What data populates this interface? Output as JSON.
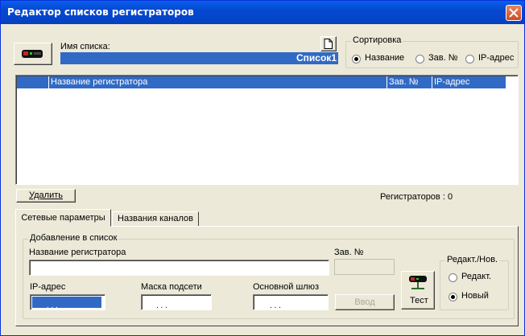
{
  "window": {
    "title": "Редактор списков регистраторов"
  },
  "list_name": {
    "label": "Имя списка:",
    "value": "Список1"
  },
  "sort": {
    "legend": "Сортировка",
    "options": [
      "Название",
      "Зав. №",
      "IP-адрес"
    ],
    "selected": "Название"
  },
  "table": {
    "columns": [
      "",
      "Название регистратора",
      "Зав. №",
      "IP-адрес"
    ],
    "rows": []
  },
  "delete_button": "Удалить",
  "recorder_count": "Регистраторов : 0",
  "tabs": [
    "Сетевые параметры",
    "Названия каналов"
  ],
  "add_group": {
    "legend": "Добавление в список",
    "name_label": "Название регистратора",
    "name_value": "",
    "serial_label": "Зав. №",
    "ip_label": "IP-адрес",
    "mask_label": "Маска подсети",
    "gateway_label": "Основной шлюз",
    "ip_placeholder": ". . .",
    "enter_button": "Ввод",
    "test_button": "Тест"
  },
  "mode_group": {
    "legend": "Редакт./Нов.",
    "options": [
      "Редакт.",
      "Новый"
    ],
    "selected": "Новый"
  },
  "colors": {
    "titlebar": "#0549d1",
    "selection": "#316ac5",
    "face": "#ece9d8"
  },
  "icons": [
    "recorder-device-icon",
    "new-document-icon",
    "close-icon",
    "network-device-icon"
  ]
}
